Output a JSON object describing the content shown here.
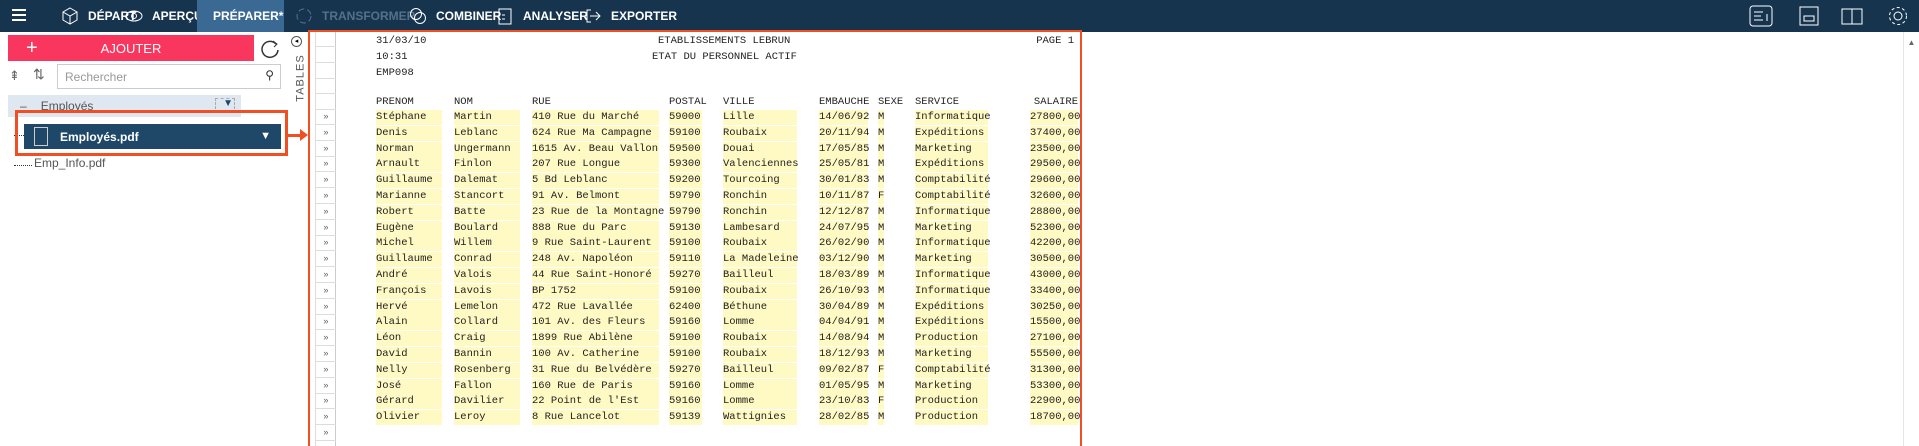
{
  "toolbar": {
    "items": [
      {
        "label": "DÉPART",
        "icon": "cube-icon"
      },
      {
        "label": "APERÇU",
        "icon": "eye-icon"
      },
      {
        "label": "PRÉPARER*",
        "icon": "prepare-icon"
      },
      {
        "label": "TRANSFORMER",
        "icon": "transform-icon"
      },
      {
        "label": "COMBINER",
        "icon": "combine-icon"
      },
      {
        "label": "ANALYSER",
        "icon": "clipboard-icon"
      },
      {
        "label": "EXPORTER",
        "icon": "export-icon"
      }
    ]
  },
  "sidebar": {
    "add_label": "AJOUTER",
    "search_placeholder": "Rechercher",
    "group": "Employés",
    "files": [
      "Employés.pdf",
      "Emp_Info.pdf"
    ],
    "tables_label": "TABLES"
  },
  "report": {
    "date": "31/03/10",
    "time": "10:31",
    "code": "EMP098",
    "company": "ETABLISSEMENTS LEBRUN",
    "title": "ETAT DU PERSONNEL ACTIF",
    "page": "PAGE 1",
    "columns": [
      "PRENOM",
      "NOM",
      "RUE",
      "POSTAL",
      "VILLE",
      "EMBAUCHE",
      "SEXE",
      "SERVICE",
      "SALAIRE"
    ],
    "rows": [
      [
        "Stéphane",
        "Martin",
        "410 Rue du Marché",
        "59000",
        "Lille",
        "14/06/92",
        "M",
        "Informatique",
        "27800,00"
      ],
      [
        "Denis",
        "Leblanc",
        "624 Rue Ma Campagne",
        "59100",
        "Roubaix",
        "20/11/94",
        "M",
        "Expéditions",
        "37400,00"
      ],
      [
        "Norman",
        "Ungermann",
        "1615 Av. Beau Vallon",
        "59500",
        "Douai",
        "17/05/85",
        "M",
        "Marketing",
        "23500,00"
      ],
      [
        "Arnault",
        "Finlon",
        "207 Rue Longue",
        "59300",
        "Valenciennes",
        "25/05/81",
        "M",
        "Expéditions",
        "29500,00"
      ],
      [
        "Guillaume",
        "Dalemat",
        "5 Bd Leblanc",
        "59200",
        "Tourcoing",
        "30/01/83",
        "M",
        "Comptabilité",
        "29600,00"
      ],
      [
        "Marianne",
        "Stancort",
        "91 Av. Belmont",
        "59790",
        "Ronchin",
        "10/11/87",
        "F",
        "Comptabilité",
        "32600,00"
      ],
      [
        "Robert",
        "Batte",
        "23 Rue de la Montagne",
        "59790",
        "Ronchin",
        "12/12/87",
        "M",
        "Informatique",
        "28800,00"
      ],
      [
        "Eugène",
        "Boulard",
        "888 Rue du Parc",
        "59130",
        "Lambesard",
        "24/07/95",
        "M",
        "Marketing",
        "52300,00"
      ],
      [
        "Michel",
        "Willem",
        "9 Rue Saint-Laurent",
        "59100",
        "Roubaix",
        "26/02/90",
        "M",
        "Informatique",
        "42200,00"
      ],
      [
        "Guillaume",
        "Conrad",
        "248 Av. Napoléon",
        "59110",
        "La Madeleine",
        "03/12/90",
        "M",
        "Marketing",
        "30500,00"
      ],
      [
        "André",
        "Valois",
        "44 Rue Saint-Honoré",
        "59270",
        "Bailleul",
        "18/03/89",
        "M",
        "Informatique",
        "43000,00"
      ],
      [
        "François",
        "Lavois",
        "BP 1752",
        "59100",
        "Roubaix",
        "26/10/93",
        "M",
        "Informatique",
        "33400,00"
      ],
      [
        "Hervé",
        "Lemelon",
        "472 Rue Lavallée",
        "62400",
        "Béthune",
        "30/04/89",
        "M",
        "Expéditions",
        "30250,00"
      ],
      [
        "Alain",
        "Collard",
        "101 Av. des Fleurs",
        "59160",
        "Lomme",
        "04/04/91",
        "M",
        "Expéditions",
        "15500,00"
      ],
      [
        "Léon",
        "Craig",
        "1899 Rue Abilène",
        "59100",
        "Roubaix",
        "14/08/94",
        "M",
        "Production",
        "27100,00"
      ],
      [
        "David",
        "Bannin",
        "100 Av. Catherine",
        "59100",
        "Roubaix",
        "18/12/93",
        "M",
        "Marketing",
        "55500,00"
      ],
      [
        "Nelly",
        "Rosenberg",
        "31 Rue du Belvédère",
        "59270",
        "Bailleul",
        "09/02/87",
        "F",
        "Comptabilité",
        "31300,00"
      ],
      [
        "José",
        "Fallon",
        "160 Rue de Paris",
        "59160",
        "Lomme",
        "01/05/95",
        "M",
        "Marketing",
        "53300,00"
      ],
      [
        "Gérard",
        "Davilier",
        "22 Point de l'Est",
        "59160",
        "Lomme",
        "23/10/83",
        "F",
        "Production",
        "22900,00"
      ],
      [
        "Olivier",
        "Leroy",
        "8 Rue Lancelot",
        "59139",
        "Wattignies",
        "28/02/85",
        "M",
        "Production",
        "18700,00"
      ]
    ]
  },
  "colors": {
    "topbar": "#17344f",
    "active": "#3a6a94",
    "add": "#f9365d",
    "highlight": "#f04e23",
    "cell": "#fff9c4"
  }
}
